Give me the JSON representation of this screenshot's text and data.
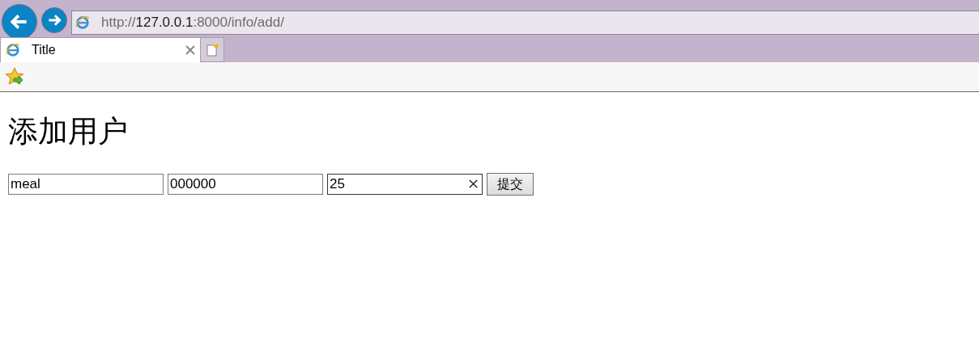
{
  "browser": {
    "address": {
      "scheme": "http://",
      "host": "127.0.0.1",
      "rest": ":8000/info/add/"
    },
    "tabs": [
      {
        "title": "Title",
        "selected": true
      }
    ]
  },
  "page": {
    "heading": "添加用户",
    "fields": [
      {
        "value": "meal",
        "focused": false
      },
      {
        "value": "000000",
        "focused": false
      },
      {
        "value": "25",
        "focused": true
      }
    ],
    "submit": "提交"
  }
}
